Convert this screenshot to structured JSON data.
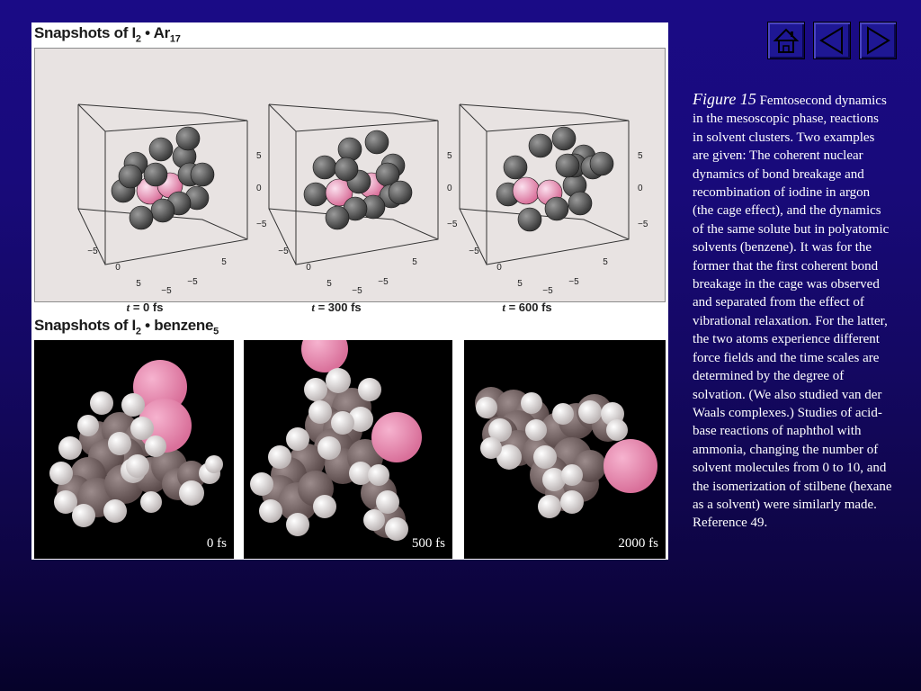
{
  "figure": {
    "ar_header": {
      "prefix": "Snapshots of I",
      "sub1": "2",
      "mid": " • Ar",
      "sub2": "17"
    },
    "ar_panels": [
      {
        "t_label": "t",
        "t_value": " = 0 fs"
      },
      {
        "t_label": "t",
        "t_value": " = 300 fs"
      },
      {
        "t_label": "t",
        "t_value": " = 600 fs"
      }
    ],
    "axis_ticks": {
      "z_top": "5",
      "z_mid": "0",
      "z_bot": "−5",
      "x_left": "−5",
      "x_mid": "0",
      "x_right": "5",
      "y_left": "5",
      "y_right": "−5",
      "y_back": "−5"
    },
    "bz_header": {
      "prefix": "Snapshots of I",
      "sub1": "2",
      "mid": " • benzene",
      "sub2": "5"
    },
    "bz_panels": [
      {
        "time": "0 fs"
      },
      {
        "time": "500 fs"
      },
      {
        "time": "2000 fs"
      }
    ],
    "colors": {
      "iodine": "#d9709a",
      "argon": "#3a3a3a",
      "carbon": "#5a4a4a",
      "hydrogen": "#f2f0f0",
      "panel_bg": "#e8e3e2"
    }
  },
  "nav": {
    "home_icon": "home-icon",
    "prev_icon": "triangle-left-icon",
    "next_icon": "triangle-right-icon"
  },
  "caption": {
    "figure_label": "Figure 15",
    "text": " Femtosecond dynamics in the mesoscopic phase, reactions in solvent clusters. Two examples are given: The coherent nuclear dynamics of bond breakage and recombination of iodine in argon (the cage effect), and the dynamics of the same solute but in polyatomic solvents (benzene). It was for the former that the first coherent bond breakage in the cage was observed and separated from the effect of vibrational relaxation. For the latter, the two atoms experience different force fields and the time scales are determined by the degree of solvation. (We also studied van der Waals complexes.) Studies of acid-base reactions of naphthol with ammonia, changing the number of solvent molecules from 0 to 10, and the isomerization of stilbene (hexane as a solvent) were similarly made. Reference 49."
  }
}
